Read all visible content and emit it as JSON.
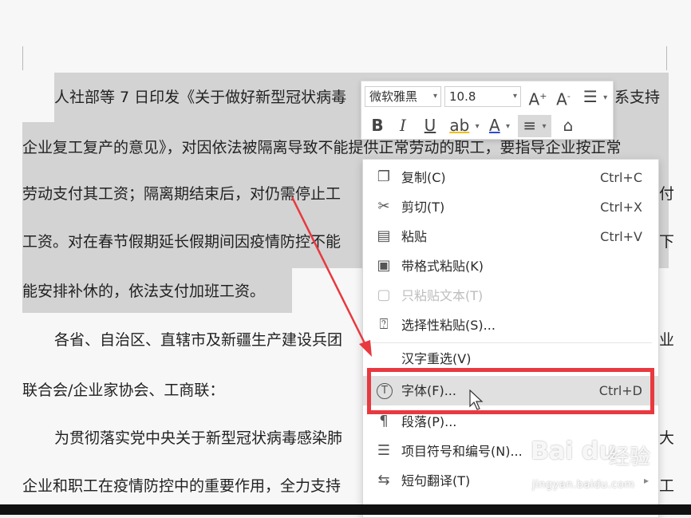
{
  "document": {
    "lines": [
      "人社部等 7 日印发《关于做好新型冠状病毒",
      "系支持",
      "企业复工复产的意见》，对因依法被隔离导致不能提供正常劳动的职工，要指导企业按正常",
      "劳动支付其工资；隔离期结束后，对仍需停止工",
      "付",
      "工资。对在春节假期延长假期间因疫情防控不能",
      "下",
      "能安排补休的，依法支付加班工资。",
      "各省、自治区、直辖市及新疆生产建设兵团",
      "业",
      "联合会/企业家协会、工商联：",
      "为贯彻落实党中央关于新型冠状病毒感染肺",
      "大",
      "企业和职工在疫情防控中的重要作用，全力支持",
      "工"
    ]
  },
  "mini_toolbar": {
    "font_name": "微软雅黑",
    "font_size": "10.8",
    "bold": "B",
    "italic": "I",
    "underline": "U",
    "highlight": "ab",
    "font_color": "A",
    "grow_font": "A",
    "shrink_font": "A"
  },
  "context_menu": {
    "items": [
      {
        "label": "复制(C)",
        "shortcut": "Ctrl+C"
      },
      {
        "label": "剪切(T)",
        "shortcut": "Ctrl+X"
      },
      {
        "label": "粘贴",
        "shortcut": "Ctrl+V"
      },
      {
        "label": "带格式粘贴(K)",
        "shortcut": ""
      },
      {
        "label": "只粘贴文本(T)",
        "shortcut": ""
      },
      {
        "label": "选择性粘贴(S)...",
        "shortcut": ""
      },
      {
        "label": "汉字重选(V)",
        "shortcut": ""
      },
      {
        "label": "字体(F)...",
        "shortcut": "Ctrl+D"
      },
      {
        "label": "段落(P)...",
        "shortcut": ""
      },
      {
        "label": "项目符号和编号(N)...",
        "shortcut": ""
      },
      {
        "label": "短句翻译(T)",
        "shortcut": ""
      }
    ]
  },
  "watermark": {
    "logo": "Bai du",
    "suffix": "经验",
    "url": "jingyan.baidu.com"
  },
  "colors": {
    "highlight_box": "#e8393f",
    "selection": "#d3d3d3",
    "arrow": "#e8393f"
  }
}
